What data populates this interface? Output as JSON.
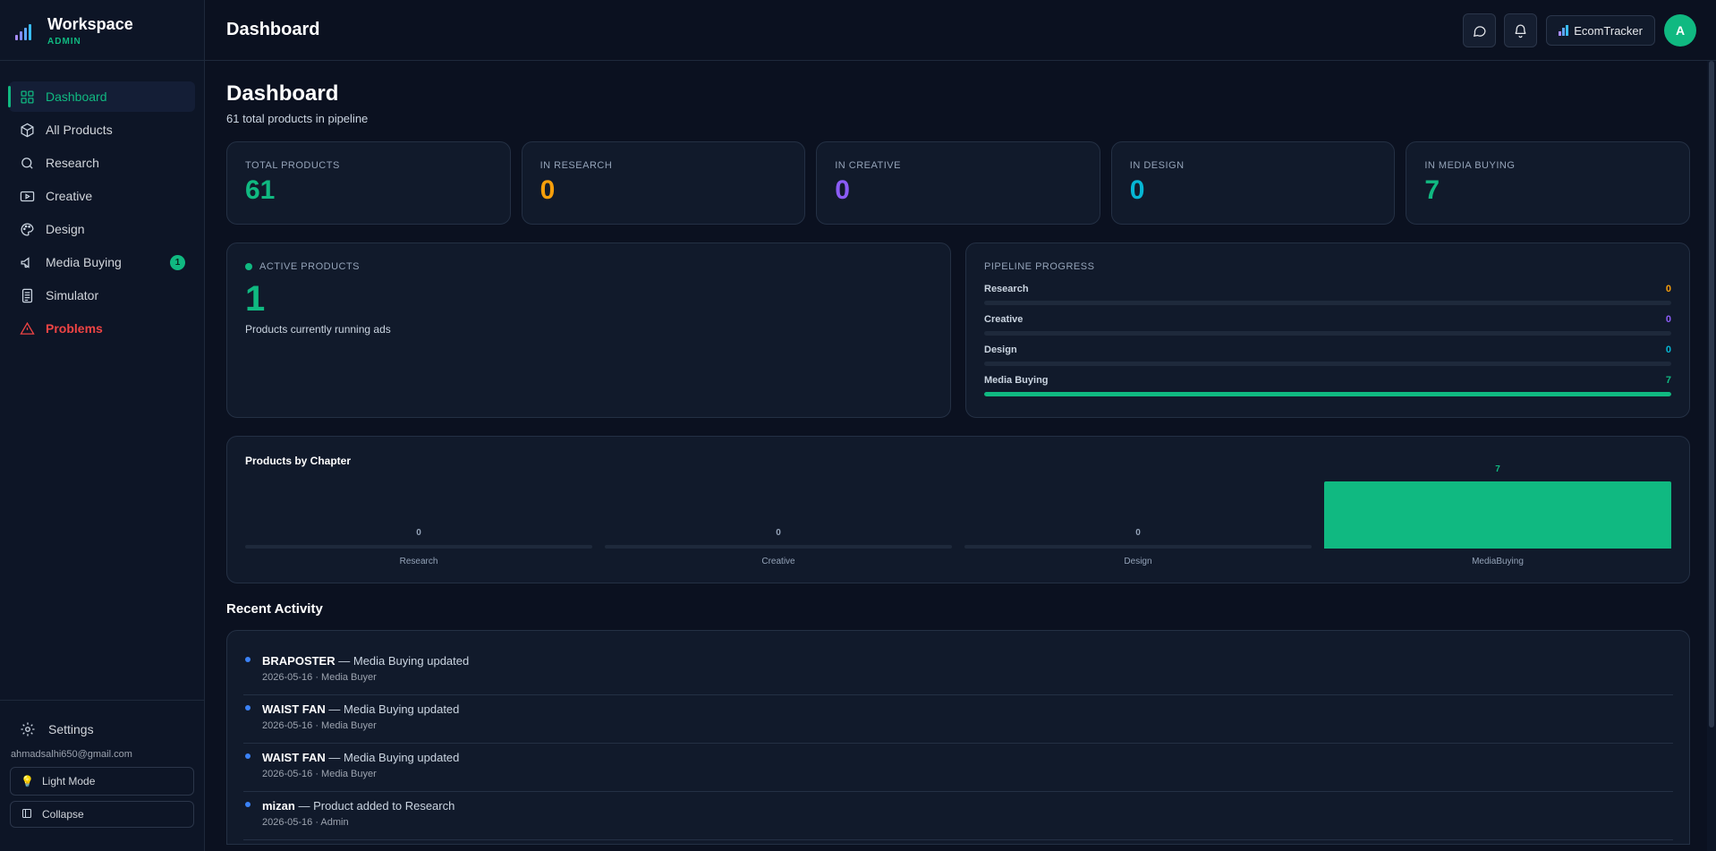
{
  "brand": {
    "title": "Workspace",
    "role": "ADMIN"
  },
  "sidebar": {
    "items": [
      {
        "label": "Dashboard",
        "icon": "grid-icon",
        "active": true
      },
      {
        "label": "All Products",
        "icon": "box-icon"
      },
      {
        "label": "Research",
        "icon": "search-icon"
      },
      {
        "label": "Creative",
        "icon": "video-icon"
      },
      {
        "label": "Design",
        "icon": "palette-icon"
      },
      {
        "label": "Media Buying",
        "icon": "megaphone-icon",
        "badge": "1"
      },
      {
        "label": "Simulator",
        "icon": "calculator-icon"
      },
      {
        "label": "Problems",
        "icon": "warning-icon"
      }
    ],
    "settings": "Settings",
    "email": "ahmadsalhi650@gmail.com",
    "light_mode": "Light Mode",
    "collapse": "Collapse"
  },
  "header": {
    "title": "Dashboard",
    "tracker_label": "EcomTracker",
    "avatar_initial": "A"
  },
  "main": {
    "title": "Dashboard",
    "subtitle": "61 total products in pipeline",
    "stats": [
      {
        "label": "TOTAL PRODUCTS",
        "value": "61",
        "color": "#10b981"
      },
      {
        "label": "IN RESEARCH",
        "value": "0",
        "color": "#f59e0b"
      },
      {
        "label": "IN CREATIVE",
        "value": "0",
        "color": "#8b5cf6"
      },
      {
        "label": "IN DESIGN",
        "value": "0",
        "color": "#06b6d4"
      },
      {
        "label": "IN MEDIA BUYING",
        "value": "7",
        "color": "#10b981"
      }
    ],
    "active": {
      "label": "ACTIVE PRODUCTS",
      "value": "1",
      "subtitle": "Products currently running ads"
    },
    "pipeline": {
      "title": "PIPELINE PROGRESS",
      "rows": [
        {
          "label": "Research",
          "value": "0",
          "fraction": 0,
          "color": "#f59e0b"
        },
        {
          "label": "Creative",
          "value": "0",
          "fraction": 0,
          "color": "#8b5cf6"
        },
        {
          "label": "Design",
          "value": "0",
          "fraction": 0,
          "color": "#06b6d4"
        },
        {
          "label": "Media Buying",
          "value": "7",
          "fraction": 1,
          "color": "#10b981"
        }
      ]
    },
    "chart_title": "Products by Chapter",
    "activity_title": "Recent Activity",
    "activity": [
      {
        "name": "BRAPOSTER",
        "action": "— Media Buying updated",
        "meta": "2026-05-16 · Media Buyer"
      },
      {
        "name": "WAIST FAN",
        "action": "— Media Buying updated",
        "meta": "2026-05-16 · Media Buyer"
      },
      {
        "name": "WAIST FAN",
        "action": "— Media Buying updated",
        "meta": "2026-05-16 · Media Buyer"
      },
      {
        "name": "mizan",
        "action": "— Product added to Research",
        "meta": "2026-05-16 · Admin"
      }
    ]
  },
  "chart_data": {
    "type": "bar",
    "title": "Products by Chapter",
    "categories": [
      "Research",
      "Creative",
      "Design",
      "MediaBuying"
    ],
    "values": [
      0,
      0,
      0,
      7
    ],
    "ylim": [
      0,
      7
    ],
    "color": "#10b981"
  }
}
